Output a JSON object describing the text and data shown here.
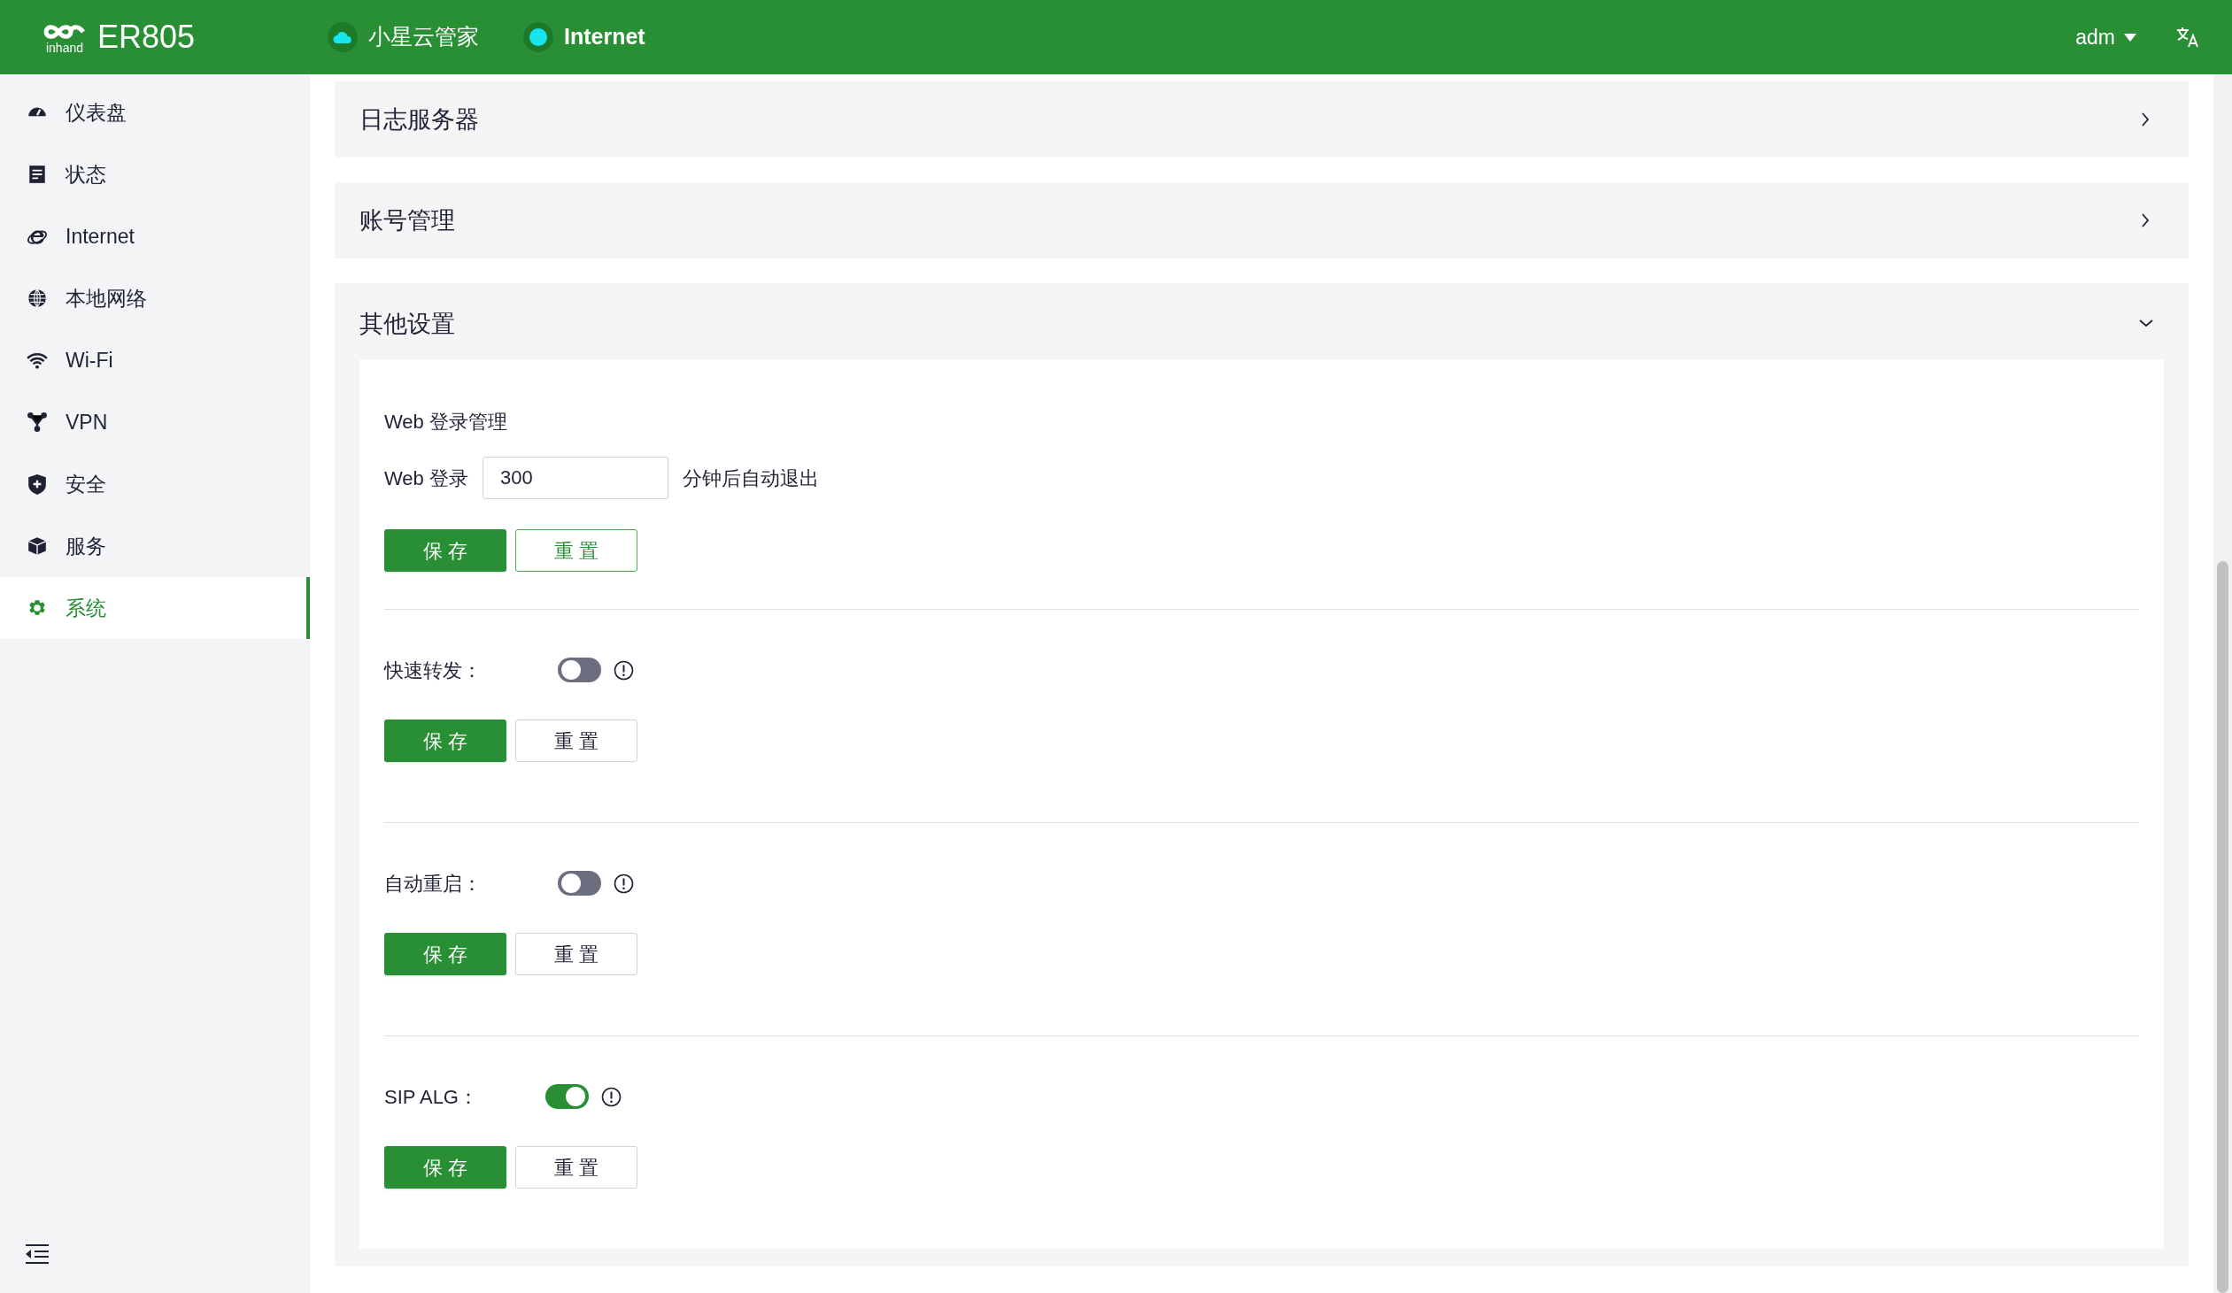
{
  "header": {
    "logo_text": "inhand",
    "product": "ER805",
    "cloud": "小星云管家",
    "internet": "Internet",
    "user": "adm"
  },
  "sidebar": {
    "items": [
      {
        "label": "仪表盘",
        "kind": "gauge",
        "selected": false
      },
      {
        "label": "状态",
        "kind": "doc",
        "selected": false
      },
      {
        "label": "Internet",
        "kind": "ie",
        "selected": false
      },
      {
        "label": "本地网络",
        "kind": "globe",
        "selected": false
      },
      {
        "label": "Wi-Fi",
        "kind": "wifi",
        "selected": false
      },
      {
        "label": "VPN",
        "kind": "nodes",
        "selected": false
      },
      {
        "label": "安全",
        "kind": "shield",
        "selected": false
      },
      {
        "label": "服务",
        "kind": "cube",
        "selected": false
      },
      {
        "label": "系统",
        "kind": "gear",
        "selected": true
      }
    ]
  },
  "panels": [
    {
      "title": "日志服务器",
      "expanded": false
    },
    {
      "title": "账号管理",
      "expanded": false
    },
    {
      "title": "其他设置",
      "expanded": true
    }
  ],
  "web_login": {
    "heading": "Web 登录管理",
    "label": "Web 登录",
    "value": "300",
    "suffix": "分钟后自动退出",
    "save": "保 存",
    "reset": "重 置",
    "reset_focused": true
  },
  "switches": [
    {
      "label": "快速转发：",
      "on": false,
      "save": "保 存",
      "reset": "重 置"
    },
    {
      "label": "自动重启：",
      "on": false,
      "save": "保 存",
      "reset": "重 置"
    },
    {
      "label": "SIP ALG：",
      "on": true,
      "save": "保 存",
      "reset": "重 置"
    }
  ]
}
